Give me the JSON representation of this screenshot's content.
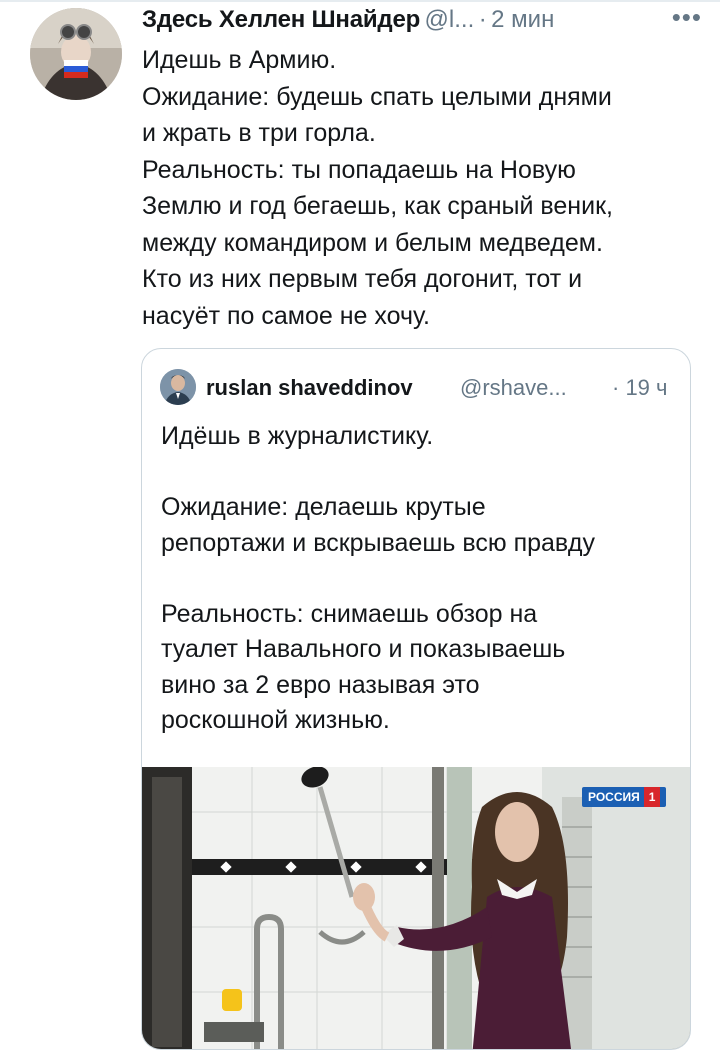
{
  "tweet": {
    "author_name": "Здесь Хеллен Шнайдер",
    "handle": "@l...",
    "dot": "·",
    "time": "2 мин",
    "more_icon": "more-horizontal-icon",
    "text_lines": [
      "Идешь в Армию.",
      "Ожидание: будешь спать целыми днями",
      "и жрать в три горла.",
      "Реальность: ты попадаешь на Новую",
      "Землю и год бегаешь, как сраный веник,",
      "между командиром и белым медведем.",
      "Кто из них первым тебя догонит, тот и",
      "насуёт по самое не хочу."
    ]
  },
  "quoted_tweet": {
    "author_name": "ruslan shaveddinov",
    "handle": "@rshave...",
    "time": "· 19 ч",
    "text_lines": [
      "Идёшь в журналистику.",
      "",
      "Ожидание: делаешь крутые",
      "репортажи и вскрываешь всю правду",
      "",
      "Реальность: снимаешь обзор на",
      "туалет Навального и показываешь",
      "вино за 2 евро называя это",
      "роскошной жизнью."
    ],
    "media": {
      "channel_logo_text": "РОССИЯ",
      "channel_logo_num": "1"
    }
  },
  "colors": {
    "text": "#14171a",
    "secondary": "#657786",
    "border": "#ccd6dd"
  }
}
